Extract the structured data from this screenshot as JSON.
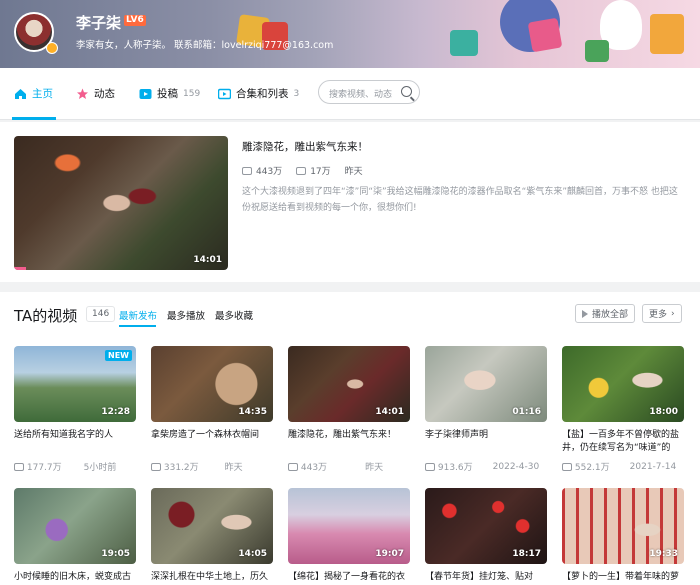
{
  "user": {
    "name": "李子柒",
    "level": "LV6",
    "sign": "李家有女，人称子柒。 联系邮箱：lovelrziqi777@163.com"
  },
  "nav": {
    "items": [
      {
        "label": "主页",
        "count": ""
      },
      {
        "label": "动态",
        "count": ""
      },
      {
        "label": "投稿",
        "count": "159"
      },
      {
        "label": "合集和列表",
        "count": "3"
      }
    ],
    "search_placeholder": "搜索视频、动态"
  },
  "featured": {
    "title": "雕漆隐花，雕出紫气东来！",
    "views": "443万",
    "danmaku": "17万",
    "time": "昨天",
    "duration": "14:01",
    "desc": "这个大漆视频退到了四年“漆”同“柒”我给这幅雕漆隐花的漆器作品取名“紫气东来”麒麟回首，万事不怒 也把这份祝愿送给看到视频的每一个你，很想你们!"
  },
  "videos": {
    "title": "TA的视频",
    "count": "146",
    "sorts": [
      "最新发布",
      "最多播放",
      "最多收藏"
    ],
    "play_all": "播放全部",
    "more": "更多",
    "row1": [
      {
        "title": "送给所有知道我名字的人",
        "views": "177.7万",
        "time": "5小时前",
        "duration": "12:28",
        "badge": "NEW"
      },
      {
        "title": "拿柴房造了一个森林衣帽间",
        "views": "331.2万",
        "time": "昨天",
        "duration": "14:35"
      },
      {
        "title": "雕漆隐花，雕出紫气东来！",
        "views": "443万",
        "time": "昨天",
        "duration": "14:01"
      },
      {
        "title": "李子柒律师声明",
        "views": "913.6万",
        "time": "2022-4-30",
        "duration": "01:16"
      },
      {
        "title": "【盐】一百多年不曾停歇的盐井，仍在续写名为“味道”的",
        "views": "552.1万",
        "time": "2021-7-14",
        "duration": "18:00"
      }
    ],
    "row2": [
      {
        "title": "小时候睡的旧木床，蜕变成古",
        "duration": "19:05"
      },
      {
        "title": "深深扎根在中华土地上，历久",
        "duration": "14:05"
      },
      {
        "title": "【绵花】揭秘了一身看花的衣",
        "duration": "19:07"
      },
      {
        "title": "【春节年货】挂灯笼、贴对",
        "duration": "18:17"
      },
      {
        "title": "【萝卜的一生】带着年味的萝",
        "duration": "19:33"
      }
    ]
  },
  "colors": {
    "accent": "#00aeec",
    "text": "#18191c",
    "muted": "#9499a0"
  }
}
